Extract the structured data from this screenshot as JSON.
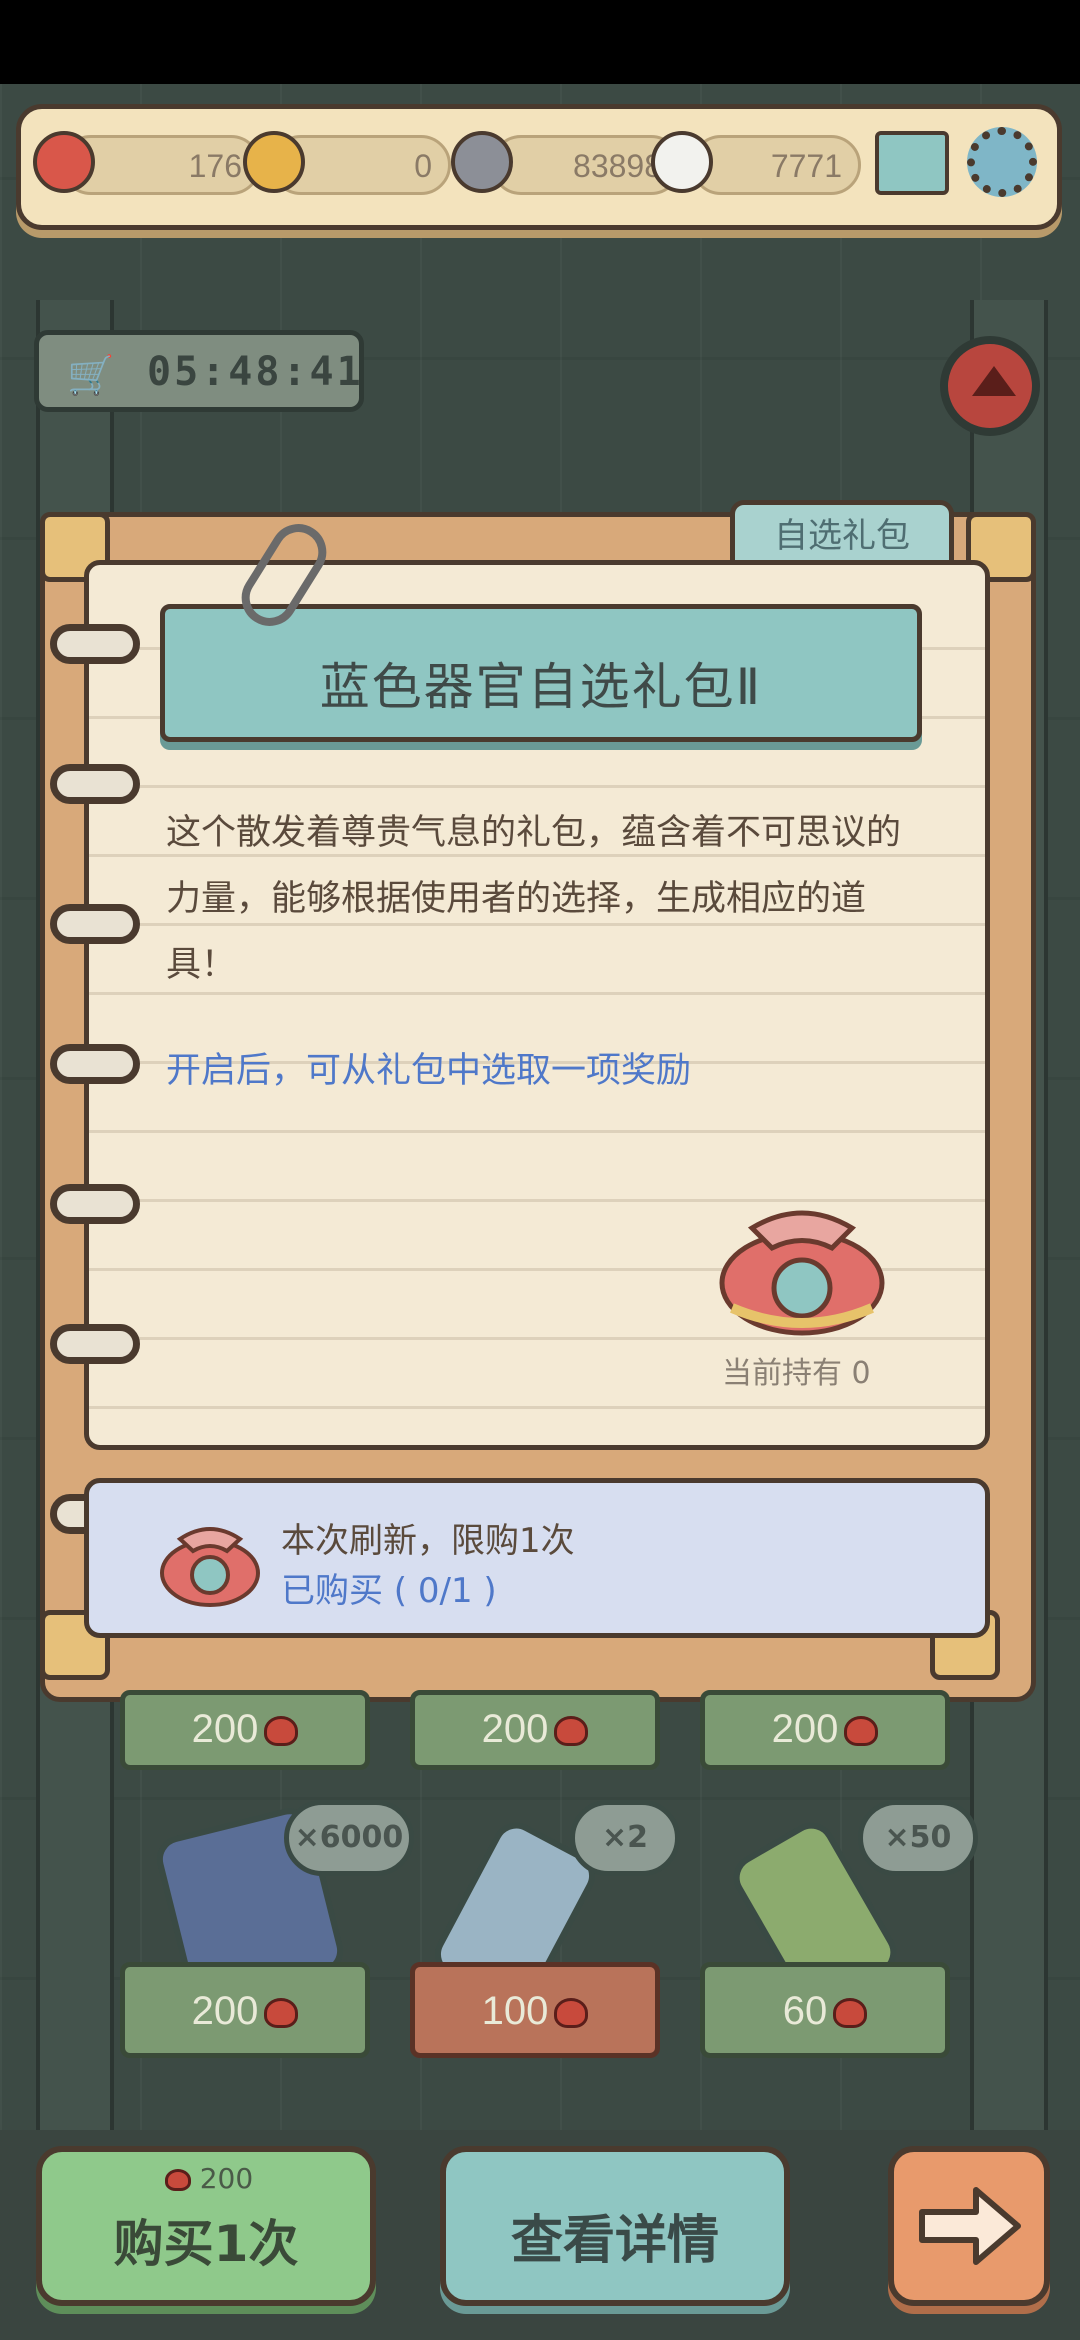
{
  "resources": [
    {
      "icon": "heart-icon",
      "value": "176"
    },
    {
      "icon": "golden-heart-icon",
      "value": "0"
    },
    {
      "icon": "grey-soul-icon",
      "value": "83898"
    },
    {
      "icon": "white-soul-icon",
      "value": "7771"
    }
  ],
  "timer": "05:48:41",
  "tab_label": "自选礼包",
  "item": {
    "title": "蓝色器官自选礼包Ⅱ",
    "description": "这个散发着尊贵气息的礼包，蕴含着不可思议的力量，能够根据使用者的选择，生成相应的道具！",
    "hint": "开启后，可从礼包中选取一项奖励",
    "held_label": "当前持有",
    "held_count": "0"
  },
  "purchase_limit": {
    "line1": "本次刷新，限购1次",
    "line2": "已购买 ( 0/1 )"
  },
  "shop_prices_row1": [
    "200",
    "200",
    "200"
  ],
  "shop_items_row2": [
    {
      "badge": "×6000",
      "price": "200"
    },
    {
      "badge": "×2",
      "price": "100"
    },
    {
      "badge": "×50",
      "price": "60"
    }
  ],
  "buttons": {
    "buy_cost": "200",
    "buy_label": "购买1次",
    "detail_label": "查看详情"
  },
  "colors": {
    "accent_blue": "#4f78c9",
    "teal": "#8fc6c2",
    "paper": "#f4ead5"
  }
}
